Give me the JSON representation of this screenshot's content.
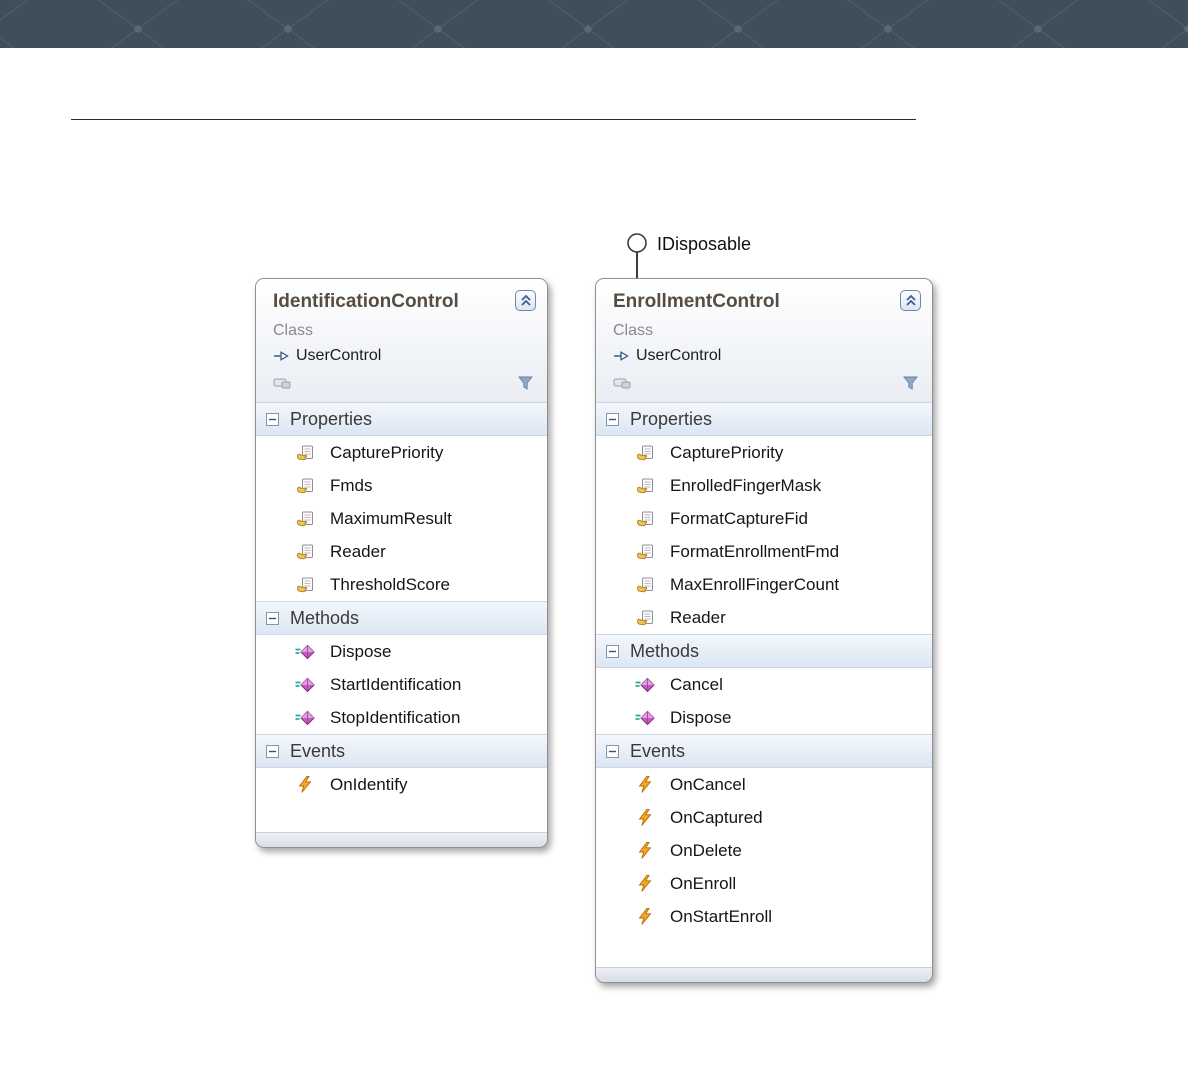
{
  "diagram": {
    "interface": {
      "label": "IDisposable"
    },
    "classes": [
      {
        "name": "IdentificationControl",
        "stereotype": "Class",
        "base": "UserControl",
        "sections": [
          {
            "title": "Properties",
            "items": [
              "CapturePriority",
              "Fmds",
              "MaximumResult",
              "Reader",
              "ThresholdScore"
            ]
          },
          {
            "title": "Methods",
            "items": [
              "Dispose",
              "StartIdentification",
              "StopIdentification"
            ]
          },
          {
            "title": "Events",
            "items": [
              "OnIdentify"
            ]
          }
        ]
      },
      {
        "name": "EnrollmentControl",
        "stereotype": "Class",
        "base": "UserControl",
        "sections": [
          {
            "title": "Properties",
            "items": [
              "CapturePriority",
              "EnrolledFingerMask",
              "FormatCaptureFid",
              "FormatEnrollmentFmd",
              "MaxEnrollFingerCount",
              "Reader"
            ]
          },
          {
            "title": "Methods",
            "items": [
              "Cancel",
              "Dispose"
            ]
          },
          {
            "title": "Events",
            "items": [
              "OnCancel",
              "OnCaptured",
              "OnDelete",
              "OnEnroll",
              "OnStartEnroll"
            ]
          }
        ]
      }
    ]
  },
  "colors": {
    "banner-bg": "#3f4e5b",
    "banner-line": "#4d5c6a",
    "section-band-top": "#f3f7fc",
    "section-band-bottom": "#dce6f3",
    "class-title": "#564c41",
    "method-icon": "#c25ec2",
    "event-icon": "#f5a52b",
    "property-hand": "#f1c44f",
    "filter-icon": "#8fa9c9"
  }
}
